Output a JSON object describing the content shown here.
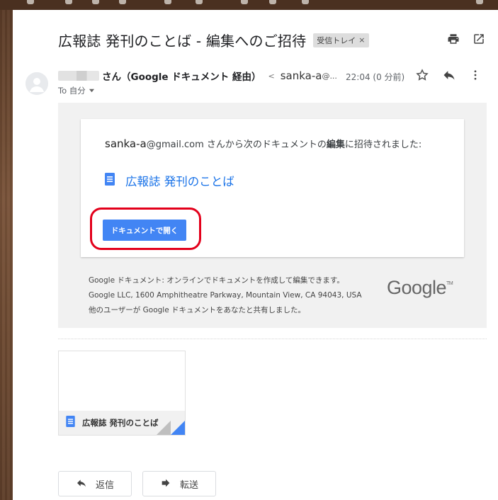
{
  "subject": "広報誌 発刊のことば - 編集へのご招待",
  "label_chip": {
    "text": "受信トレイ",
    "close": "×"
  },
  "sender": {
    "name": "さん（Google ドキュメント 経由）",
    "lt": "<",
    "email": "sanka-a",
    "email_suffix": "@...",
    "time": "22:04 (0 分前)"
  },
  "to_line": "To 自分",
  "invite": {
    "email_user": "sanka-a",
    "email_domain": "@gmail.com",
    "text_1": " さんから次のドキュメントの",
    "text_bold": "編集",
    "text_2": "に招待されました:",
    "doc_title": "広報誌 発刊のことば",
    "open_button": "ドキュメントで開く"
  },
  "footer": {
    "line_1": "Google ドキュメント: オンラインでドキュメントを作成して編集できます。",
    "line_2": "Google LLC, 1600 Amphitheatre Parkway, Mountain View, CA 94043, USA",
    "line_3": "他のユーザーが Google ドキュメントをあなたと共有しました。",
    "logo": "Google",
    "logo_tm": "TM"
  },
  "attachment": {
    "name": "広報誌 発刊のことば"
  },
  "actions": {
    "reply": "返信",
    "forward": "転送"
  },
  "colors": {
    "link_blue": "#1a73e8",
    "button_blue": "#4285f4",
    "highlight_red": "#e3001b",
    "gray_bg": "#f1f1f1"
  },
  "icons": [
    "print-icon",
    "open-in-new-window-icon",
    "star-icon",
    "reply-icon",
    "more-vertical-icon",
    "google-docs-icon",
    "dropdown-arrow-icon",
    "forward-icon",
    "avatar-icon"
  ]
}
